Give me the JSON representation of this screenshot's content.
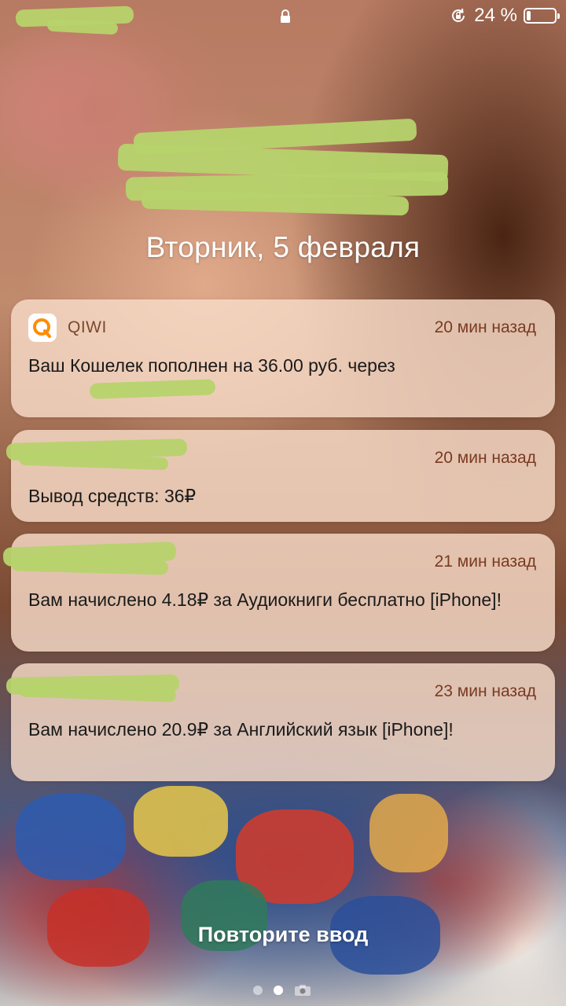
{
  "status_bar": {
    "battery_text": "24 %",
    "battery_level_percent": 24
  },
  "lock_screen": {
    "date": "Вторник, 5 февраля",
    "retry_text": "Повторите ввод"
  },
  "notifications": [
    {
      "app_name": "QIWI",
      "time": "20 мин назад",
      "body": "Ваш Кошелек пополнен на 36.00 руб. через"
    },
    {
      "app_name": "",
      "time": "20 мин назад",
      "body": "Вывод средств: 36₽"
    },
    {
      "app_name": "",
      "time": "21 мин назад",
      "body": "Вам начислено 4.18₽ за Аудиокниги бесплатно [iPhone]!"
    },
    {
      "app_name": "",
      "time": "23 мин назад",
      "body": "Вам начислено 20.9₽ за Английский язык [iPhone]!"
    }
  ],
  "colors": {
    "qiwi_accent": "#ff8c00",
    "redaction": "#b6d36b"
  },
  "icons": [
    "lock-icon",
    "rotation-lock-icon",
    "battery-icon",
    "qiwi-app-icon",
    "camera-icon"
  ]
}
